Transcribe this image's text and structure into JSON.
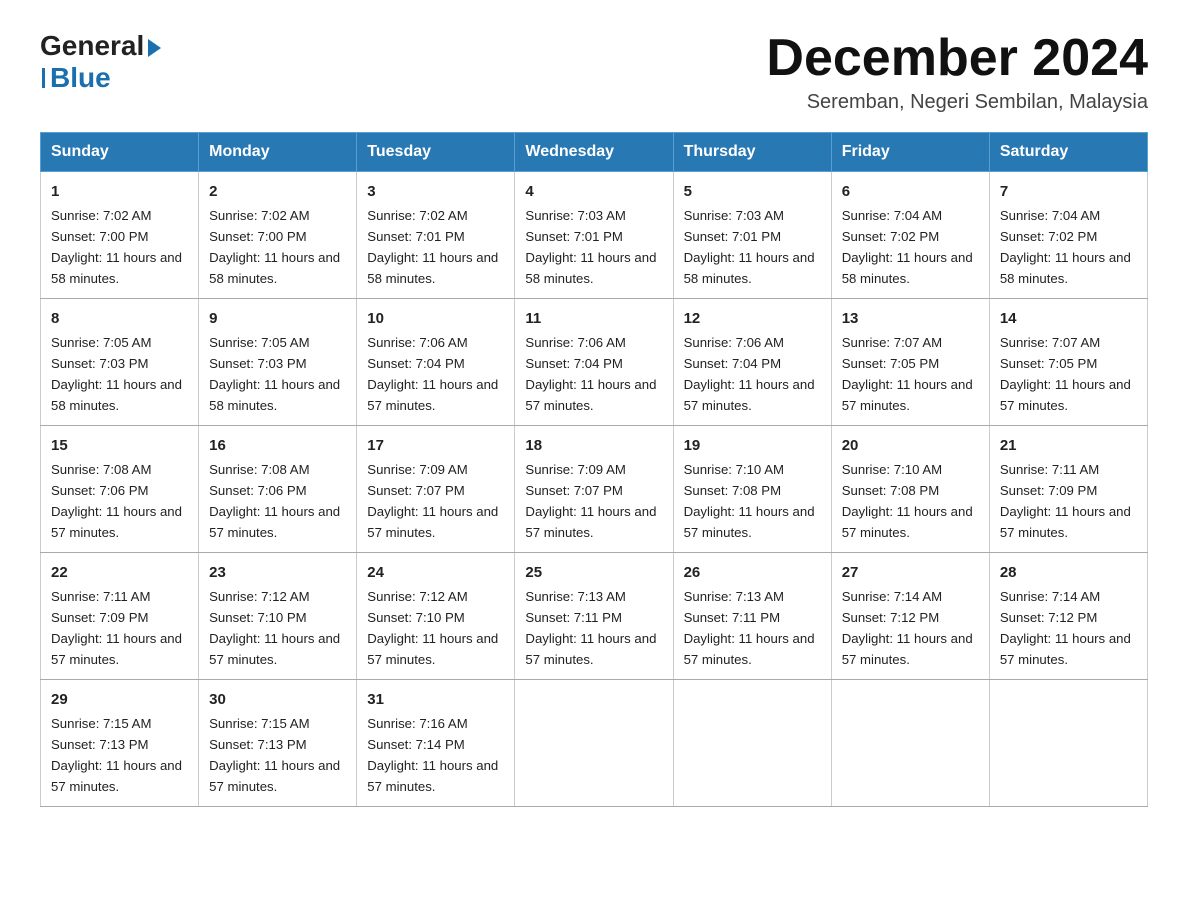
{
  "header": {
    "title": "December 2024",
    "location": "Seremban, Negeri Sembilan, Malaysia",
    "logo_general": "General",
    "logo_blue": "Blue"
  },
  "days_of_week": [
    "Sunday",
    "Monday",
    "Tuesday",
    "Wednesday",
    "Thursday",
    "Friday",
    "Saturday"
  ],
  "weeks": [
    [
      {
        "day": "1",
        "sunrise": "7:02 AM",
        "sunset": "7:00 PM",
        "daylight": "11 hours and 58 minutes."
      },
      {
        "day": "2",
        "sunrise": "7:02 AM",
        "sunset": "7:00 PM",
        "daylight": "11 hours and 58 minutes."
      },
      {
        "day": "3",
        "sunrise": "7:02 AM",
        "sunset": "7:01 PM",
        "daylight": "11 hours and 58 minutes."
      },
      {
        "day": "4",
        "sunrise": "7:03 AM",
        "sunset": "7:01 PM",
        "daylight": "11 hours and 58 minutes."
      },
      {
        "day": "5",
        "sunrise": "7:03 AM",
        "sunset": "7:01 PM",
        "daylight": "11 hours and 58 minutes."
      },
      {
        "day": "6",
        "sunrise": "7:04 AM",
        "sunset": "7:02 PM",
        "daylight": "11 hours and 58 minutes."
      },
      {
        "day": "7",
        "sunrise": "7:04 AM",
        "sunset": "7:02 PM",
        "daylight": "11 hours and 58 minutes."
      }
    ],
    [
      {
        "day": "8",
        "sunrise": "7:05 AM",
        "sunset": "7:03 PM",
        "daylight": "11 hours and 58 minutes."
      },
      {
        "day": "9",
        "sunrise": "7:05 AM",
        "sunset": "7:03 PM",
        "daylight": "11 hours and 58 minutes."
      },
      {
        "day": "10",
        "sunrise": "7:06 AM",
        "sunset": "7:04 PM",
        "daylight": "11 hours and 57 minutes."
      },
      {
        "day": "11",
        "sunrise": "7:06 AM",
        "sunset": "7:04 PM",
        "daylight": "11 hours and 57 minutes."
      },
      {
        "day": "12",
        "sunrise": "7:06 AM",
        "sunset": "7:04 PM",
        "daylight": "11 hours and 57 minutes."
      },
      {
        "day": "13",
        "sunrise": "7:07 AM",
        "sunset": "7:05 PM",
        "daylight": "11 hours and 57 minutes."
      },
      {
        "day": "14",
        "sunrise": "7:07 AM",
        "sunset": "7:05 PM",
        "daylight": "11 hours and 57 minutes."
      }
    ],
    [
      {
        "day": "15",
        "sunrise": "7:08 AM",
        "sunset": "7:06 PM",
        "daylight": "11 hours and 57 minutes."
      },
      {
        "day": "16",
        "sunrise": "7:08 AM",
        "sunset": "7:06 PM",
        "daylight": "11 hours and 57 minutes."
      },
      {
        "day": "17",
        "sunrise": "7:09 AM",
        "sunset": "7:07 PM",
        "daylight": "11 hours and 57 minutes."
      },
      {
        "day": "18",
        "sunrise": "7:09 AM",
        "sunset": "7:07 PM",
        "daylight": "11 hours and 57 minutes."
      },
      {
        "day": "19",
        "sunrise": "7:10 AM",
        "sunset": "7:08 PM",
        "daylight": "11 hours and 57 minutes."
      },
      {
        "day": "20",
        "sunrise": "7:10 AM",
        "sunset": "7:08 PM",
        "daylight": "11 hours and 57 minutes."
      },
      {
        "day": "21",
        "sunrise": "7:11 AM",
        "sunset": "7:09 PM",
        "daylight": "11 hours and 57 minutes."
      }
    ],
    [
      {
        "day": "22",
        "sunrise": "7:11 AM",
        "sunset": "7:09 PM",
        "daylight": "11 hours and 57 minutes."
      },
      {
        "day": "23",
        "sunrise": "7:12 AM",
        "sunset": "7:10 PM",
        "daylight": "11 hours and 57 minutes."
      },
      {
        "day": "24",
        "sunrise": "7:12 AM",
        "sunset": "7:10 PM",
        "daylight": "11 hours and 57 minutes."
      },
      {
        "day": "25",
        "sunrise": "7:13 AM",
        "sunset": "7:11 PM",
        "daylight": "11 hours and 57 minutes."
      },
      {
        "day": "26",
        "sunrise": "7:13 AM",
        "sunset": "7:11 PM",
        "daylight": "11 hours and 57 minutes."
      },
      {
        "day": "27",
        "sunrise": "7:14 AM",
        "sunset": "7:12 PM",
        "daylight": "11 hours and 57 minutes."
      },
      {
        "day": "28",
        "sunrise": "7:14 AM",
        "sunset": "7:12 PM",
        "daylight": "11 hours and 57 minutes."
      }
    ],
    [
      {
        "day": "29",
        "sunrise": "7:15 AM",
        "sunset": "7:13 PM",
        "daylight": "11 hours and 57 minutes."
      },
      {
        "day": "30",
        "sunrise": "7:15 AM",
        "sunset": "7:13 PM",
        "daylight": "11 hours and 57 minutes."
      },
      {
        "day": "31",
        "sunrise": "7:16 AM",
        "sunset": "7:14 PM",
        "daylight": "11 hours and 57 minutes."
      },
      null,
      null,
      null,
      null
    ]
  ]
}
